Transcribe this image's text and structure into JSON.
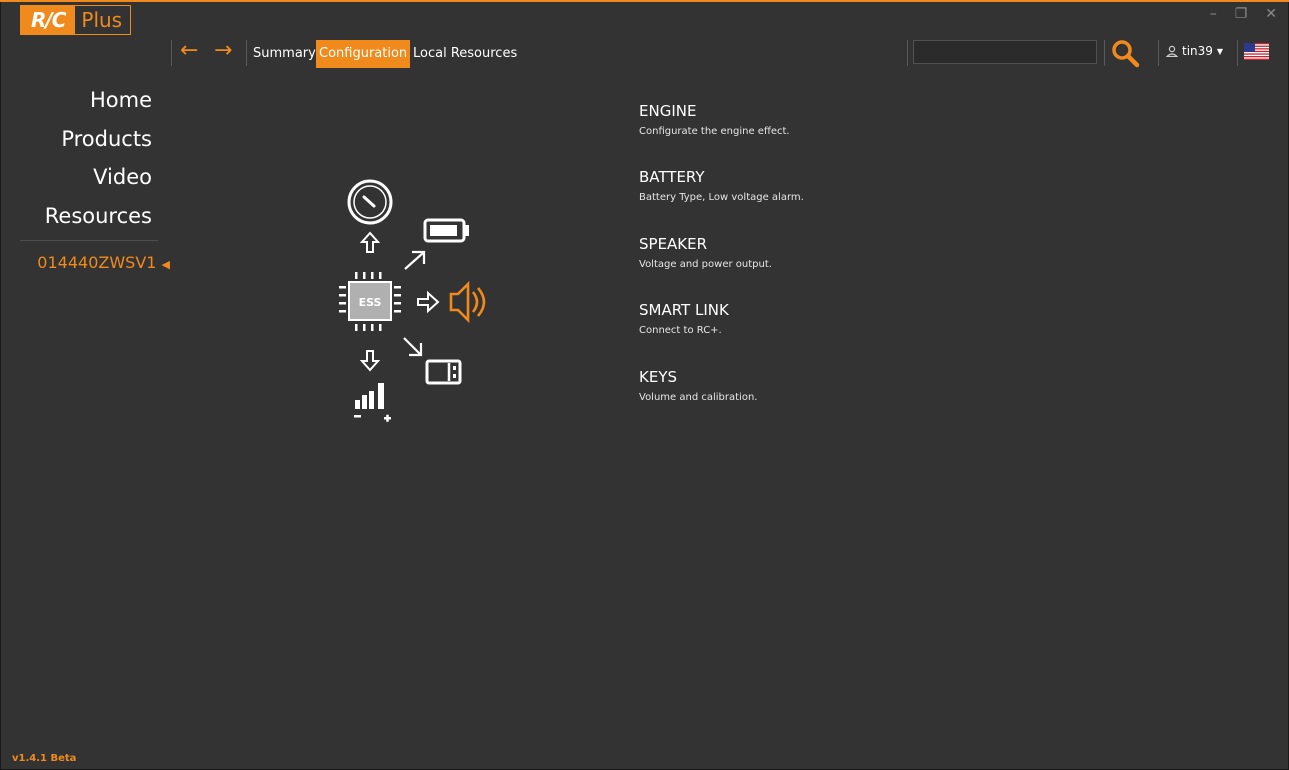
{
  "app": {
    "logo_rc": "R/C",
    "logo_plus": "Plus",
    "version": "v1.4.1 Beta"
  },
  "window_controls": {
    "minimize": "–",
    "restore": "❐",
    "close": "✕"
  },
  "toolbar": {
    "back": "←",
    "forward": "→",
    "tabs": [
      {
        "label": "Summary",
        "active": false
      },
      {
        "label": "Configuration",
        "active": true
      },
      {
        "label": "Local Resources",
        "active": false
      }
    ],
    "search_value": "",
    "user": "tin39"
  },
  "sidebar": {
    "items": [
      "Home",
      "Products",
      "Video",
      "Resources"
    ],
    "device": "014440ZWSV1"
  },
  "diagram": {
    "chip_label": "ESS"
  },
  "config": [
    {
      "title": "ENGINE",
      "desc": "Configurate the engine effect."
    },
    {
      "title": "BATTERY",
      "desc": "Battery Type, Low voltage alarm."
    },
    {
      "title": "SPEAKER",
      "desc": "Voltage and power output."
    },
    {
      "title": "SMART LINK",
      "desc": "Connect to RC+."
    },
    {
      "title": "KEYS",
      "desc": "Volume and calibration."
    }
  ],
  "colors": {
    "accent": "#f08a1c",
    "background": "#333333"
  }
}
